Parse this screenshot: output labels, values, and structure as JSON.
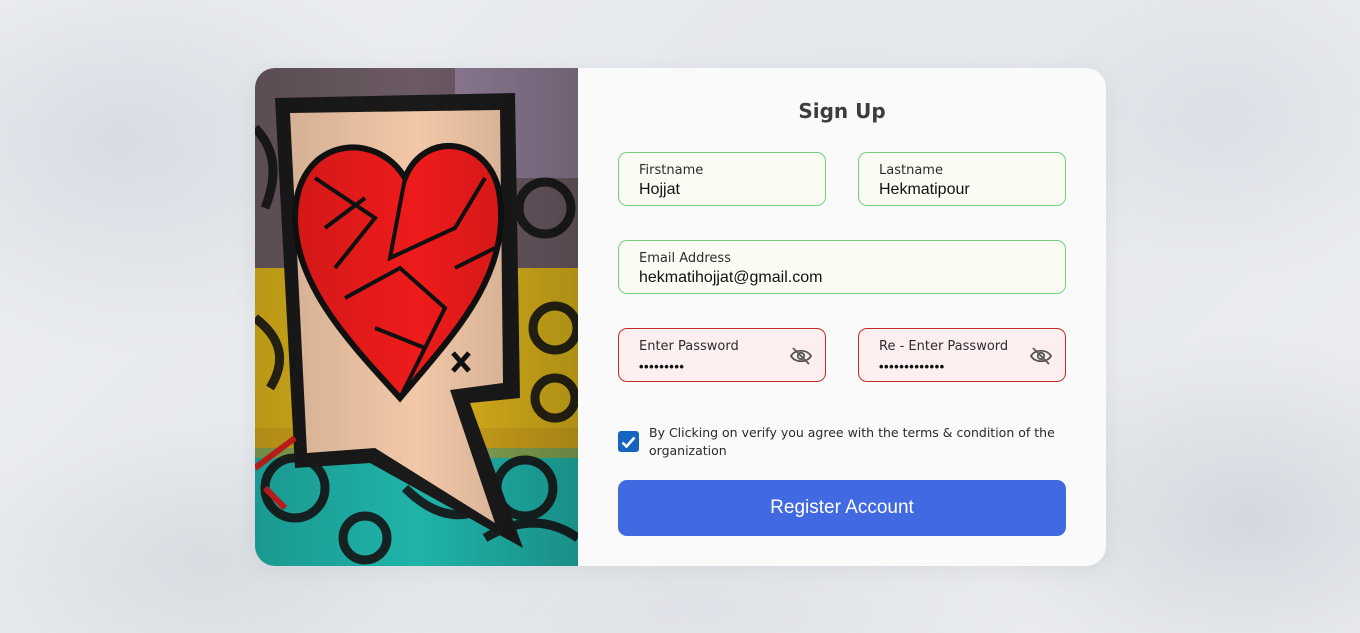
{
  "form": {
    "title": "Sign Up",
    "firstname": {
      "label": "Firstname",
      "value": "Hojjat"
    },
    "lastname": {
      "label": "Lastname",
      "value": "Hekmatipour"
    },
    "email": {
      "label": "Email Address",
      "value": "hekmatihojjat@gmail.com"
    },
    "password": {
      "label": "Enter Password",
      "value": "•••••••••",
      "icon": "eye-off-icon"
    },
    "repassword": {
      "label": "Re - Enter Password",
      "value": "•••••••••••••",
      "icon": "eye-off-icon"
    },
    "terms": {
      "checked": true,
      "text": "By Clicking on verify you agree with the terms & condition of the organization"
    },
    "submit_label": "Register Account"
  },
  "colors": {
    "accent": "#4169e1",
    "valid_border": "#6fd37d",
    "error_border": "#c22b2b",
    "checkbox": "#1565c0"
  }
}
